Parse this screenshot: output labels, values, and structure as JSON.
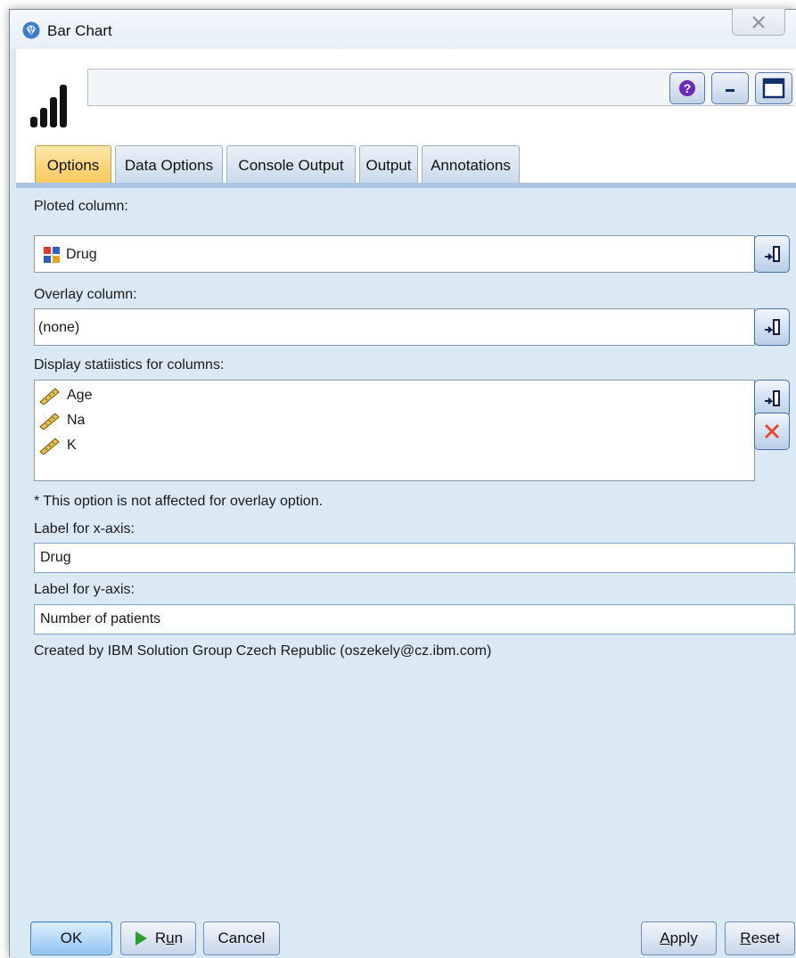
{
  "window": {
    "title": "Bar Chart"
  },
  "tabs": [
    {
      "label": "Options",
      "active": true
    },
    {
      "label": "Data Options",
      "active": false
    },
    {
      "label": "Console Output",
      "active": false
    },
    {
      "label": "Output",
      "active": false
    },
    {
      "label": "Annotations",
      "active": false
    }
  ],
  "options": {
    "ploted_column_label": "Ploted column:",
    "ploted_column_value": "Drug",
    "overlay_column_label": "Overlay column:",
    "overlay_column_value": "(none)",
    "display_stats_label": "Display statiistics for columns:",
    "display_stats_items": [
      "Age",
      "Na",
      "K"
    ],
    "note": "* This option is not affected for overlay option.",
    "x_axis_label": "Label for x-axis:",
    "x_axis_value": "Drug",
    "y_axis_label": "Label for y-axis:",
    "y_axis_value": "Number of patients",
    "credit": "Created by IBM Solution Group Czech Republic (oszekely@cz.ibm.com)"
  },
  "buttons": {
    "ok": "OK",
    "run_prefix": "R",
    "run_mnemonic": "u",
    "run_suffix": "n",
    "cancel": "Cancel",
    "apply_mnemonic": "A",
    "apply_rest": "pply",
    "reset_mnemonic": "R",
    "reset_rest": "eset"
  },
  "colors": {
    "accent": "#f7c75a",
    "background": "#dbe9f5",
    "run_icon": "#2e9e2e",
    "delete_icon": "#e8462c",
    "help_icon": "#6a2bb8"
  }
}
